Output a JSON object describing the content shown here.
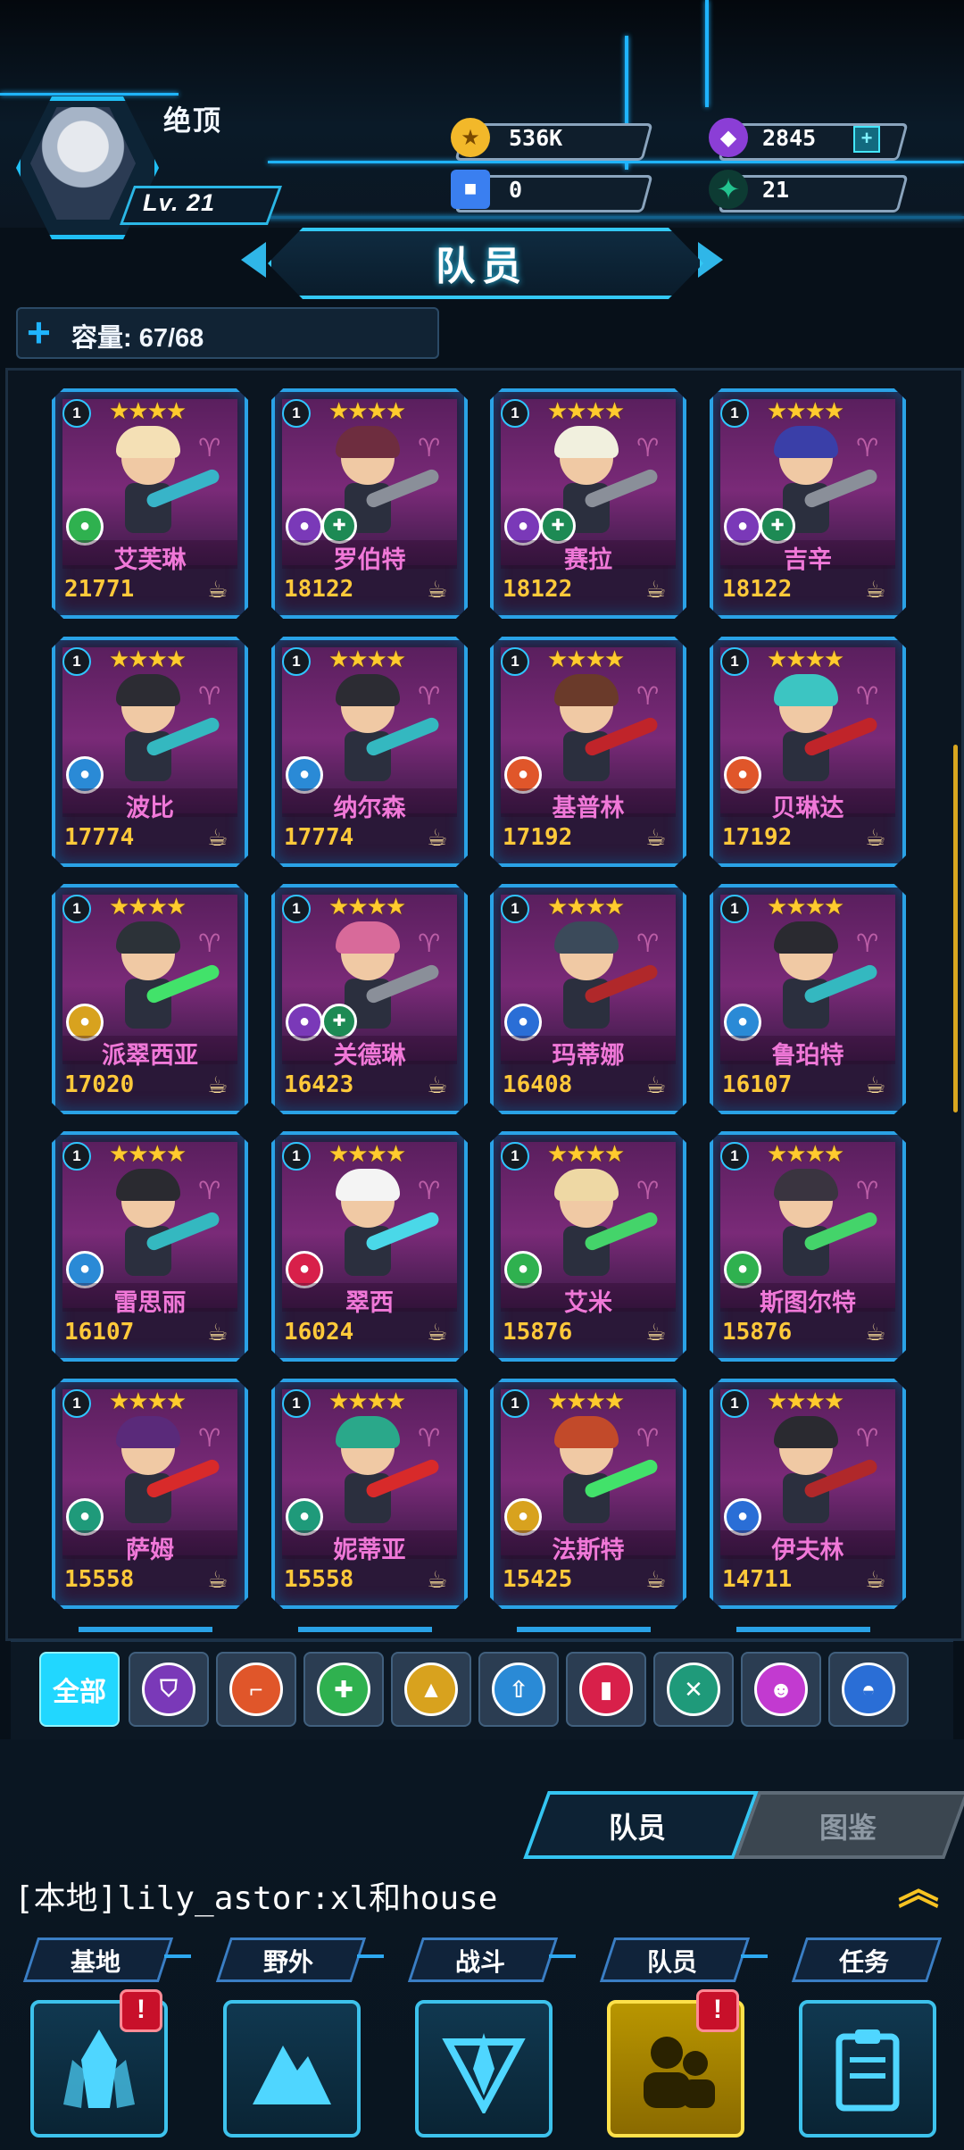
{
  "player": {
    "name": "绝顶",
    "level": "Lv. 21"
  },
  "resources": [
    {
      "icon": "gold-coin-icon",
      "value": "536K",
      "color": "#f2b82a"
    },
    {
      "icon": "purple-gem-icon",
      "value": "2845",
      "color": "#8b3ed6"
    },
    {
      "icon": "blue-cube-icon",
      "value": "0",
      "color": "#3a7ff0"
    },
    {
      "icon": "green-star-icon",
      "value": "21",
      "color": "#23c38f"
    }
  ],
  "page": {
    "title": "队员",
    "capacity": "容量: 67/68"
  },
  "heroes": [
    {
      "name": "艾芙琳",
      "power": "21771",
      "level": "1",
      "stars": "★★★★",
      "hair": "#f4e0b5",
      "class_icon": "medic-icon",
      "class_color": "#2fb14f",
      "sub": false,
      "weapon": "#38b4c8"
    },
    {
      "name": "罗伯特",
      "power": "18122",
      "level": "1",
      "stars": "★★★★",
      "hair": "#6e2d3f",
      "class_icon": "shield-icon",
      "class_color": "#7a39b8",
      "sub": true,
      "weapon": "#8a8f99"
    },
    {
      "name": "赛拉",
      "power": "18122",
      "level": "1",
      "stars": "★★★★",
      "hair": "#f1f0de",
      "class_icon": "shield-icon",
      "class_color": "#7a39b8",
      "sub": true,
      "weapon": "#8a8f99"
    },
    {
      "name": "吉辛",
      "power": "18122",
      "level": "1",
      "stars": "★★★★",
      "hair": "#3a3fa8",
      "class_icon": "shield-icon",
      "class_color": "#7a39b8",
      "sub": true,
      "weapon": "#8a8f99"
    },
    {
      "name": "波比",
      "power": "17774",
      "level": "1",
      "stars": "★★★★",
      "hair": "#2c2c33",
      "class_icon": "rocket-icon",
      "class_color": "#2a8ad6",
      "sub": false,
      "weapon": "#34b8c0"
    },
    {
      "name": "纳尔森",
      "power": "17774",
      "level": "1",
      "stars": "★★★★",
      "hair": "#2c2c33",
      "class_icon": "rocket-icon",
      "class_color": "#2a8ad6",
      "sub": false,
      "weapon": "#34b8c0"
    },
    {
      "name": "基普林",
      "power": "17192",
      "level": "1",
      "stars": "★★★★",
      "hair": "#6a3a2a",
      "class_icon": "rifle-icon",
      "class_color": "#e0562a",
      "sub": false,
      "weapon": "#c0242a"
    },
    {
      "name": "贝琳达",
      "power": "17192",
      "level": "1",
      "stars": "★★★★",
      "hair": "#3cc5c2",
      "class_icon": "rifle-icon",
      "class_color": "#e0562a",
      "sub": false,
      "weapon": "#c0242a"
    },
    {
      "name": "派翠西亚",
      "power": "17020",
      "level": "1",
      "stars": "★★★★",
      "hair": "#2c3238",
      "class_icon": "cone-icon",
      "class_color": "#d8a21e",
      "sub": false,
      "weapon": "#42e26a"
    },
    {
      "name": "关德琳",
      "power": "16423",
      "level": "1",
      "stars": "★★★★",
      "hair": "#d86a9a",
      "class_icon": "shield-icon",
      "class_color": "#7a39b8",
      "sub": true,
      "weapon": "#8a8f99"
    },
    {
      "name": "玛蒂娜",
      "power": "16408",
      "level": "1",
      "stars": "★★★★",
      "hair": "#3b4a5a",
      "class_icon": "helmet-icon",
      "class_color": "#2a6ed6",
      "sub": false,
      "weapon": "#b0282a"
    },
    {
      "name": "鲁珀特",
      "power": "16107",
      "level": "1",
      "stars": "★★★★",
      "hair": "#2a2a30",
      "class_icon": "rocket-icon",
      "class_color": "#2a8ad6",
      "sub": false,
      "weapon": "#34b8c0"
    },
    {
      "name": "雷思丽",
      "power": "16107",
      "level": "1",
      "stars": "★★★★",
      "hair": "#2a2a30",
      "class_icon": "rocket-icon",
      "class_color": "#2a8ad6",
      "sub": false,
      "weapon": "#34b8c0"
    },
    {
      "name": "翠西",
      "power": "16024",
      "level": "1",
      "stars": "★★★★",
      "hair": "#f4f4f4",
      "class_icon": "fuel-icon",
      "class_color": "#d8204a",
      "sub": false,
      "weapon": "#4ad8e8"
    },
    {
      "name": "艾米",
      "power": "15876",
      "level": "1",
      "stars": "★★★★",
      "hair": "#eed8a4",
      "class_icon": "medic-icon",
      "class_color": "#2fb14f",
      "sub": false,
      "weapon": "#44d46a"
    },
    {
      "name": "斯图尔特",
      "power": "15876",
      "level": "1",
      "stars": "★★★★",
      "hair": "#3a3440",
      "class_icon": "medic-icon",
      "class_color": "#2fb14f",
      "sub": false,
      "weapon": "#44d46a"
    },
    {
      "name": "萨姆",
      "power": "15558",
      "level": "1",
      "stars": "★★★★",
      "hair": "#5a2a7a",
      "class_icon": "tools-icon",
      "class_color": "#1f9a7a",
      "sub": false,
      "weapon": "#d82a2a"
    },
    {
      "name": "妮蒂亚",
      "power": "15558",
      "level": "1",
      "stars": "★★★★",
      "hair": "#2aa88a",
      "class_icon": "tools-icon",
      "class_color": "#1f9a7a",
      "sub": false,
      "weapon": "#d82a2a"
    },
    {
      "name": "法斯特",
      "power": "15425",
      "level": "1",
      "stars": "★★★★",
      "hair": "#c24a2a",
      "class_icon": "cone-icon",
      "class_color": "#d8a21e",
      "sub": false,
      "weapon": "#42e26a"
    },
    {
      "name": "伊夫林",
      "power": "14711",
      "level": "1",
      "stars": "★★★★",
      "hair": "#2a2a30",
      "class_icon": "helmet-icon",
      "class_color": "#2a6ed6",
      "sub": false,
      "weapon": "#b0282a"
    }
  ],
  "filters": {
    "all_label": "全部",
    "items": [
      {
        "icon": "shield-icon",
        "color": "#7a39b8",
        "glyph": "⛉"
      },
      {
        "icon": "rifle-icon",
        "color": "#e0562a",
        "glyph": "⌐"
      },
      {
        "icon": "medic-icon",
        "color": "#2fb14f",
        "glyph": "✚"
      },
      {
        "icon": "cone-icon",
        "color": "#d8a21e",
        "glyph": "▲"
      },
      {
        "icon": "rocket-icon",
        "color": "#2a8ad6",
        "glyph": "⇧"
      },
      {
        "icon": "fuel-icon",
        "color": "#d8204a",
        "glyph": "▮"
      },
      {
        "icon": "tools-icon",
        "color": "#1f9a7a",
        "glyph": "✕"
      },
      {
        "icon": "ghost-icon",
        "color": "#c23ad0",
        "glyph": "☻"
      },
      {
        "icon": "helmet-icon",
        "color": "#2a6ed6",
        "glyph": "◓"
      }
    ]
  },
  "subtabs": {
    "team": "队员",
    "book": "图鉴"
  },
  "chat": {
    "message": "[本地]lily_astor:xl和house"
  },
  "nav": [
    {
      "label": "基地",
      "icon": "crystal-base-icon",
      "badge": "!"
    },
    {
      "label": "野外",
      "icon": "mountain-icon",
      "badge": ""
    },
    {
      "label": "战斗",
      "icon": "battle-emblem-icon",
      "badge": ""
    },
    {
      "label": "队员",
      "icon": "team-members-icon",
      "badge": "!"
    },
    {
      "label": "任务",
      "icon": "clipboard-icon",
      "badge": ""
    }
  ]
}
